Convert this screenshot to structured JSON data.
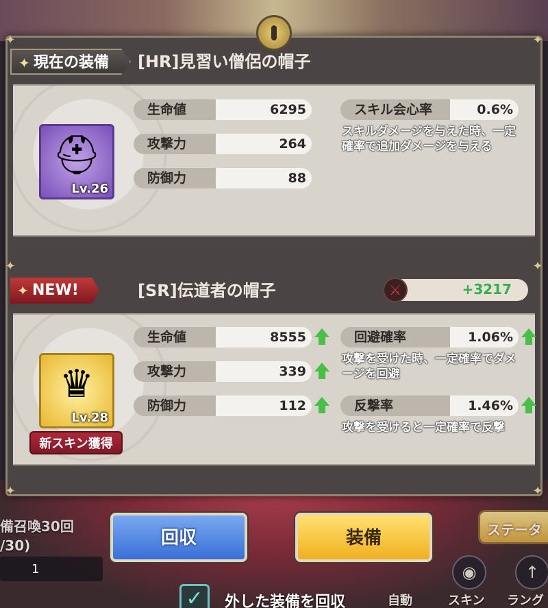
{
  "background": {
    "summon_text": "備召喚30回",
    "summon_count": "/30)",
    "left_box_value": "1",
    "status_button": "ステータ",
    "auto_label": "自動",
    "skin_label": "スキン",
    "rank_label": "ラング"
  },
  "current": {
    "tag": "現在の装備",
    "title": "[HR]見習い僧侶の帽子",
    "level": "Lv.26",
    "stats": [
      {
        "label": "生命値",
        "value": "6295"
      },
      {
        "label": "攻撃力",
        "value": "264"
      },
      {
        "label": "防御力",
        "value": "88"
      }
    ],
    "skill": {
      "label": "スキル会心率",
      "value": "0.6%",
      "desc": "スキルダメージを与えた時、一定確率で追加ダメージを与える"
    }
  },
  "new_item": {
    "tag": "NEW!",
    "title": "[SR]伝道者の帽子",
    "power_delta": "+3217",
    "level": "Lv.28",
    "new_skin": "新スキン獲得",
    "stats": [
      {
        "label": "生命値",
        "value": "8555"
      },
      {
        "label": "攻撃力",
        "value": "339"
      },
      {
        "label": "防御力",
        "value": "112"
      }
    ],
    "skills": [
      {
        "label": "回避確率",
        "value": "1.06%",
        "desc": "攻撃を受けた時、一定確率でダメージを回避"
      },
      {
        "label": "反撃率",
        "value": "1.46%",
        "desc": "攻撃を受けると一定確率で反撃"
      }
    ]
  },
  "buttons": {
    "recover": "回収",
    "equip": "装備",
    "checkbox_label": "外した装備を回収"
  },
  "colors": {
    "stat_up": "#48c048",
    "power_positive": "#30b050",
    "new_tag": "#c03838",
    "recover_button": "#3a70d8",
    "equip_button": "#f0b020"
  }
}
